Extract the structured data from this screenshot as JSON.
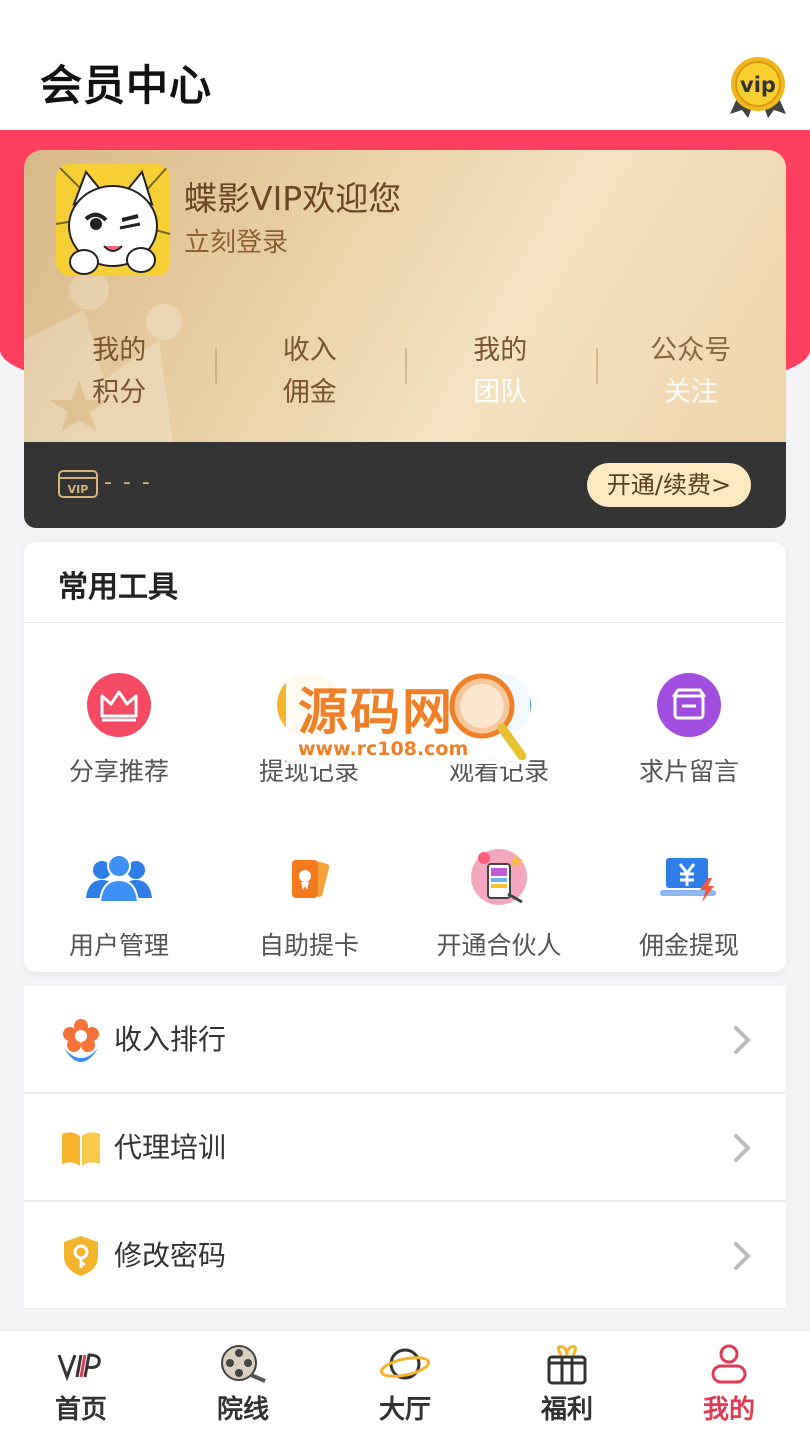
{
  "header": {
    "title": "会员中心",
    "badge_text": "vip"
  },
  "profile": {
    "welcome": "蝶影VIP欢迎您",
    "login": "立刻登录",
    "stats": [
      {
        "line1": "我的",
        "line2": "积分"
      },
      {
        "line1": "收入",
        "line2": "佣金"
      },
      {
        "line1": "我的",
        "line2": "团队"
      },
      {
        "line1": "公众号",
        "line2": "关注"
      }
    ]
  },
  "vip_bar": {
    "card_icon_text": "VIP",
    "status": "- - -",
    "renew_label": "开通/续费>"
  },
  "tools": {
    "title": "常用工具",
    "items": [
      {
        "label": "分享推荐",
        "icon": "crown-icon"
      },
      {
        "label": "提现记录",
        "icon": "withdraw-record-icon"
      },
      {
        "label": "观看记录",
        "icon": "watch-history-icon"
      },
      {
        "label": "求片留言",
        "icon": "store-icon"
      },
      {
        "label": "用户管理",
        "icon": "users-icon"
      },
      {
        "label": "自助提卡",
        "icon": "card-icon"
      },
      {
        "label": "开通合伙人",
        "icon": "partner-icon"
      },
      {
        "label": "佣金提现",
        "icon": "yen-laptop-icon"
      }
    ]
  },
  "watermark": {
    "main": "源码网",
    "url": "www.rc108.com"
  },
  "menu": [
    {
      "label": "收入排行",
      "icon": "flower-icon"
    },
    {
      "label": "代理培训",
      "icon": "book-icon"
    },
    {
      "label": "修改密码",
      "icon": "key-shield-icon"
    }
  ],
  "tabbar": [
    {
      "label": "首页",
      "icon": "vip-logo-icon",
      "active": false
    },
    {
      "label": "院线",
      "icon": "film-reel-icon",
      "active": false
    },
    {
      "label": "大厅",
      "icon": "planet-icon",
      "active": false
    },
    {
      "label": "福利",
      "icon": "gift-icon",
      "active": false
    },
    {
      "label": "我的",
      "icon": "user-icon",
      "active": true
    }
  ],
  "colors": {
    "accent_pink": "#ff3f5f",
    "gold": "#e9cfa4",
    "dark_bar": "#343434",
    "renew_bg": "#fdeac2",
    "active_tab": "#e03a55"
  }
}
